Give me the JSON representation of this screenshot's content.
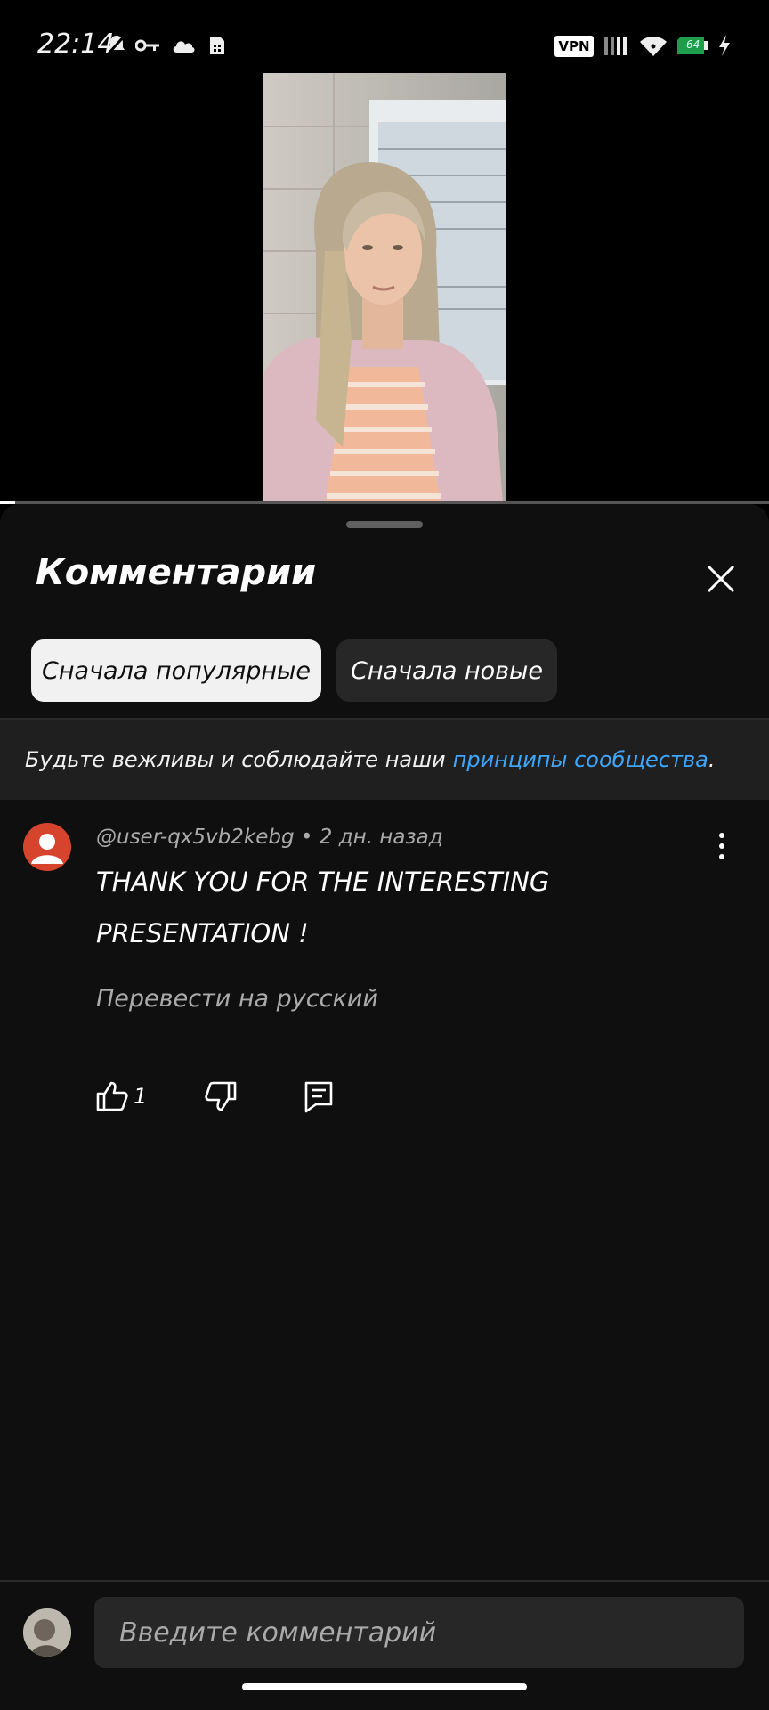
{
  "status_bar": {
    "time": "22:14",
    "vpn_label": "VPN",
    "battery_level": "64",
    "icons": [
      "dnd-icon",
      "key-icon",
      "cloud-icon",
      "sim-icon",
      "signal-icon",
      "wifi-icon",
      "battery-icon",
      "charging-icon"
    ]
  },
  "video": {
    "progress": 0.02,
    "fullscreen_icon": "fullscreen-icon"
  },
  "comments_panel": {
    "title": "Комментарии",
    "close_icon": "close-icon",
    "sort_chips": [
      {
        "label": "Сначала популярные",
        "active": true
      },
      {
        "label": "Сначала новые",
        "active": false
      }
    ],
    "notice_text": "Будьте вежливы и соблюдайте наши",
    "notice_link": "принципы сообщества",
    "notice_end": "."
  },
  "comments": [
    {
      "author": "@user-qx5vb2kebg",
      "separator": "•",
      "time_ago": "2 дн. назад",
      "text": "THANK YOU FOR THE INTERESTING PRESENTATION !",
      "translate_label": "Перевести на русский",
      "likes": "1"
    }
  ],
  "comment_input": {
    "placeholder": "Введите комментарий"
  },
  "colors": {
    "sheet_bg": "#0f0f0f",
    "chip_active": "#f1f1f1",
    "chip_inactive": "#272727",
    "link": "#3ea6ff",
    "avatar": "#d6442d",
    "battery": "#1e9e4a"
  }
}
